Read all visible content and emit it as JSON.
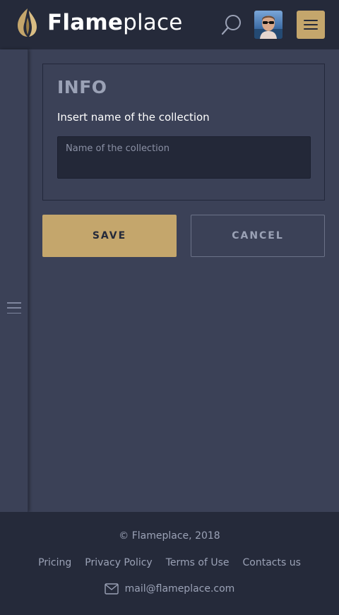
{
  "header": {
    "logo_bold": "Flame",
    "logo_light": "place",
    "search_icon": "search-icon",
    "menu_icon": "hamburger-icon"
  },
  "colors": {
    "accent": "#c4a66c",
    "header_bg": "#252a3a",
    "page_bg": "#3b4157",
    "input_bg": "#232838"
  },
  "panel": {
    "title": "INFO",
    "label": "Insert name of the collection",
    "input_placeholder": "Name of the collection",
    "input_value": ""
  },
  "actions": {
    "save_label": "SAVE",
    "cancel_label": "CANCEL"
  },
  "footer": {
    "copyright": "© Flameplace, 2018",
    "links": [
      "Pricing",
      "Privacy Policy",
      "Terms of Use",
      "Contacts us"
    ],
    "email": "mail@flameplace.com",
    "mail_icon": "mail-icon"
  }
}
